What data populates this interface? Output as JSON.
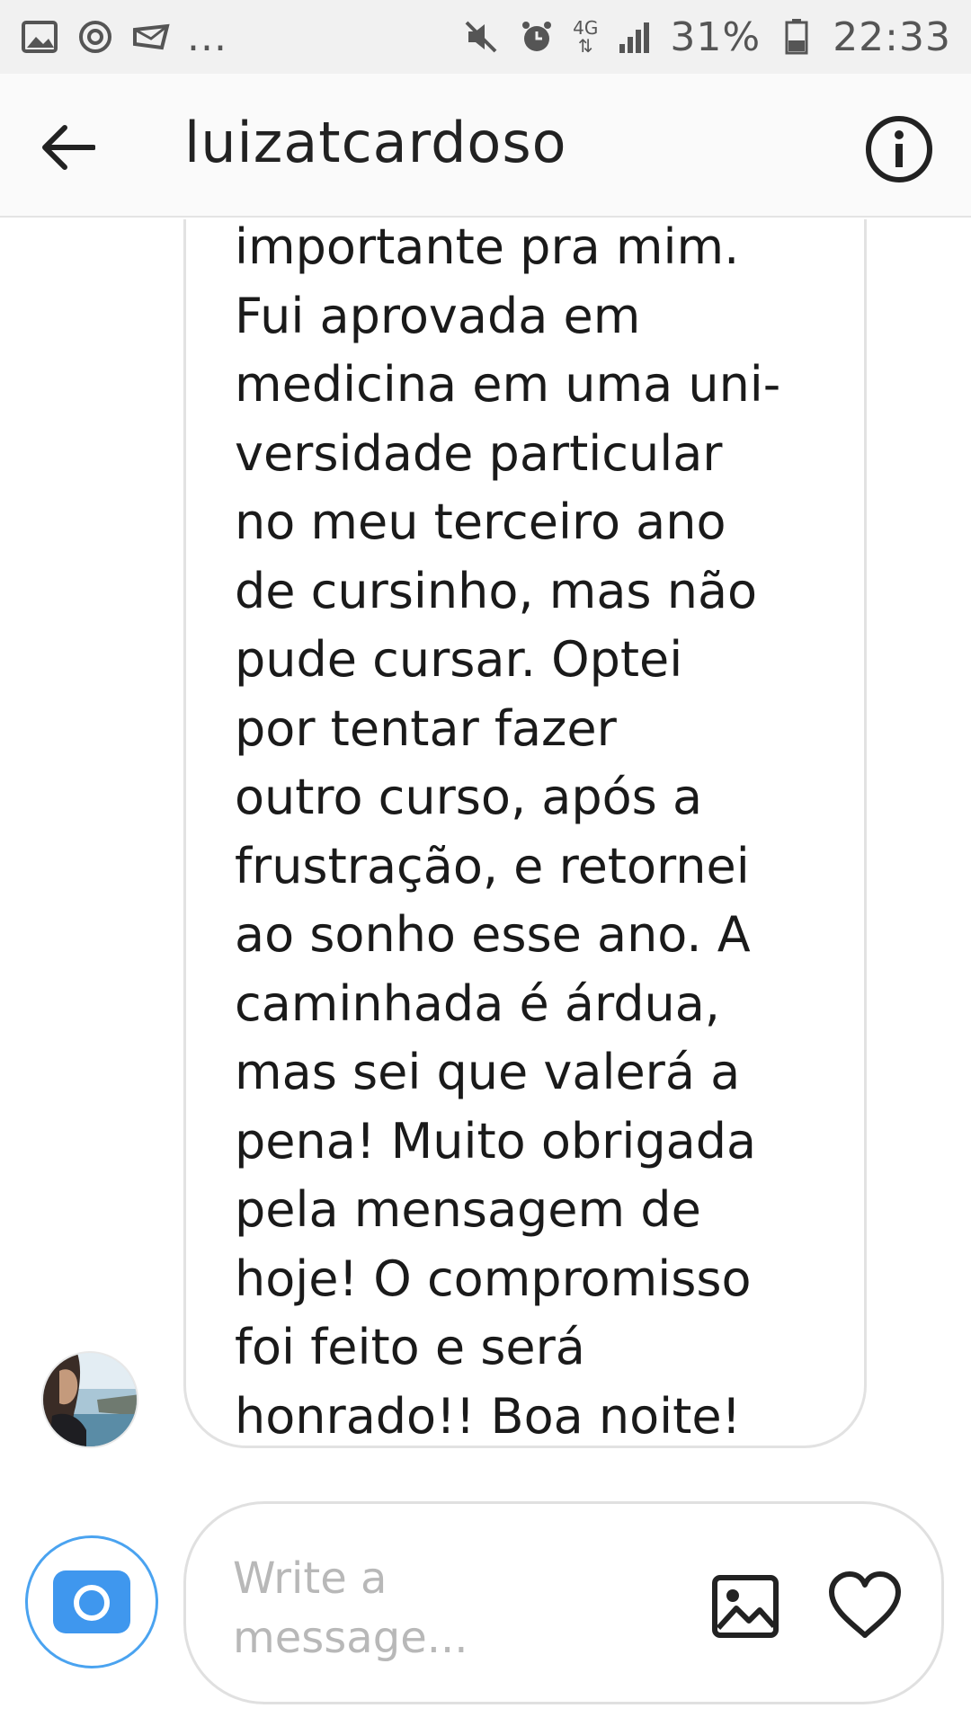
{
  "status_bar": {
    "left_icons": [
      "gallery-icon",
      "sync-icon",
      "mail-icon"
    ],
    "more": "...",
    "network": "4G",
    "battery": "31%",
    "time": "22:33"
  },
  "header": {
    "title": "luizatcardoso"
  },
  "message": {
    "text": "importante pra mim.\nFui aprovada em\nmedicina em uma uni-\nversidade particular\nno meu terceiro ano\nde cursinho, mas não\npude cursar. Optei\npor tentar fazer\noutro curso, após a\nfrustração, e retornei\nao sonho esse ano. A\ncaminhada é árdua,\nmas sei que valerá a\npena! Muito obrigada\npela mensagem de\nhoje! O compromisso\nfoi feito e será\nhonrado!! Boa noite!"
  },
  "composer": {
    "placeholder": "Write a message..."
  },
  "colors": {
    "accent": "#3f97ee",
    "bubble_border": "#e2e2e2",
    "status_bar_bg": "#f1f1f1"
  }
}
